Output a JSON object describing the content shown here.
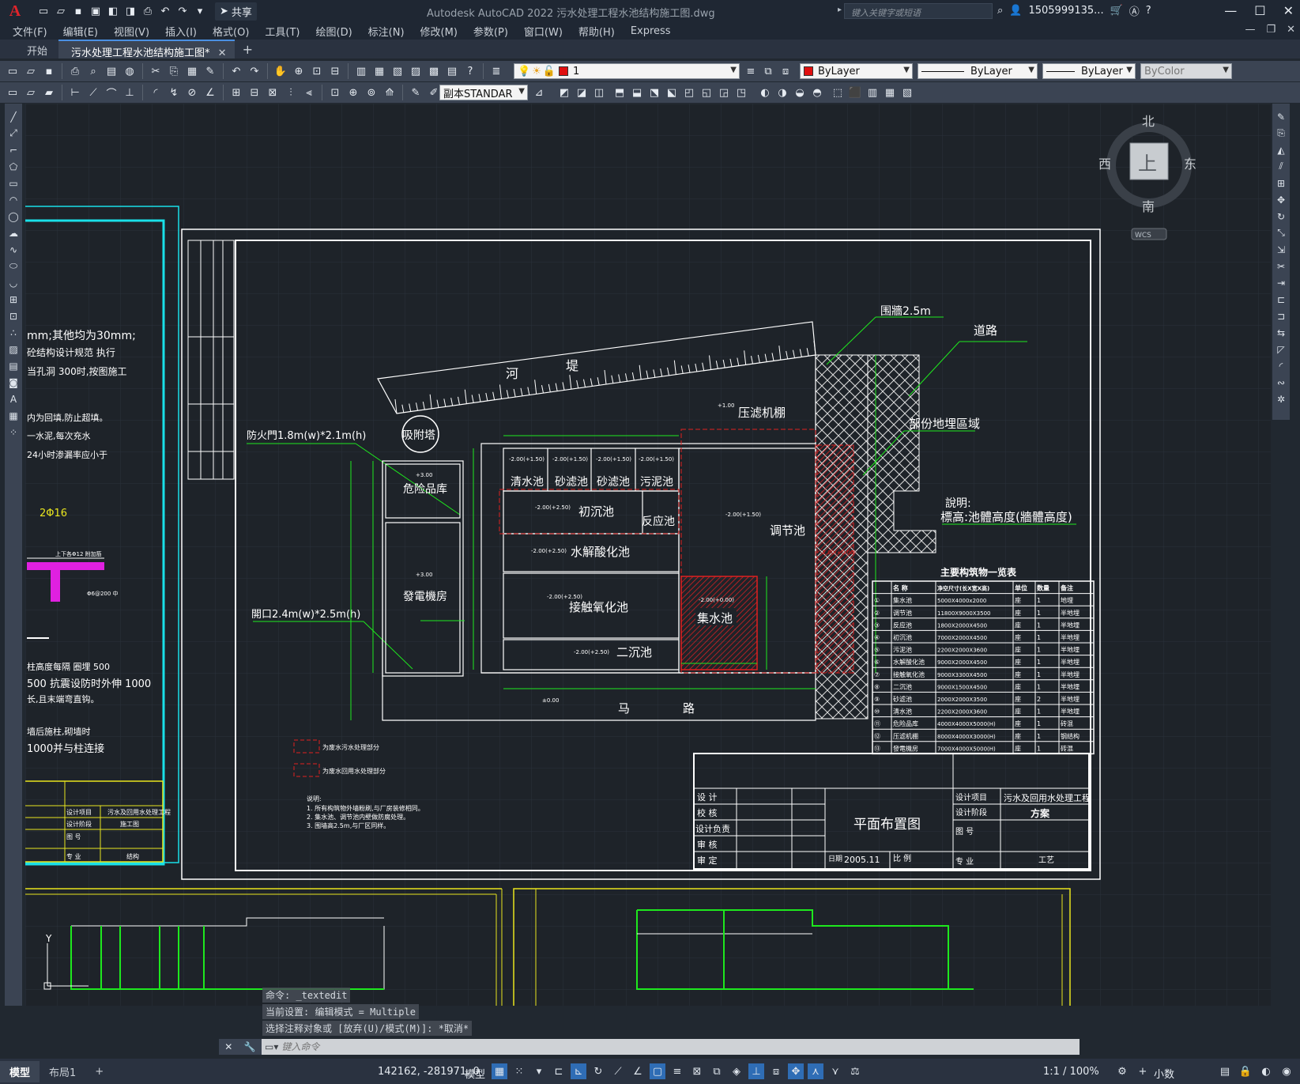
{
  "titlebar": {
    "app_logo": "A",
    "share_label": "共享",
    "window_title": "Autodesk AutoCAD 2022    污水处理工程水池结构施工图.dwg",
    "search_placeholder": "键入关键字或短语",
    "user_name": "1505999135...",
    "controls": [
      "—",
      "☐",
      "✕"
    ]
  },
  "menus": [
    "文件(F)",
    "编辑(E)",
    "视图(V)",
    "插入(I)",
    "格式(O)",
    "工具(T)",
    "绘图(D)",
    "标注(N)",
    "修改(M)",
    "参数(P)",
    "窗口(W)",
    "帮助(H)",
    "Express"
  ],
  "tabs": {
    "start": "开始",
    "active": "污水处理工程水池结构施工图*",
    "close": "✕",
    "add": "+"
  },
  "toolbar1": {
    "layer_value": "1",
    "color_value": "ByLayer",
    "linetype_value": "ByLayer",
    "lineweight_value": "ByLayer",
    "plotstyle_value": "ByColor"
  },
  "toolbar2": {
    "textstyle_value": "副本STANDAR"
  },
  "viewcube": {
    "north": "北",
    "south": "南",
    "east": "东",
    "west": "西",
    "top": "上",
    "wcs": "WCS"
  },
  "drawing": {
    "left_notes": [
      "mm;其他均为30mm;",
      "砼结构设计规范 执行",
      "当孔洞 300时,按图施工",
      "内为回填,防止超填。",
      "一水泥,每次充水",
      "24小时渗漏率应小于",
      "2Φ16",
      "上下各Φ12 附加筋",
      "Φ6@200 中",
      "柱高度每隔  圈埋   500",
      "500 抗震设防时外伸 1000",
      "长,且末端弯直钩。",
      "墙后施柱,砌墙时",
      "1000并与柱连接"
    ],
    "left_title": {
      "item": "设计项目",
      "item_value": "污水及回用水处理工程",
      "stage": "设计阶段",
      "stage_value": "施工图",
      "drawing_no": "图 号",
      "major": "专 业",
      "major_value": "结构"
    },
    "labels": {
      "river_bank_1": "河",
      "river_bank_2": "堤",
      "wall": "围牆2.5m",
      "road_label": "道路",
      "partial_buried": "部份地埋區域",
      "adsorption_tower": "吸附塔",
      "filter_press": "压滤机棚",
      "fire_door": "防火門1.8m(w)*2.1m(h)",
      "hazard_store": "危险品库",
      "generator_room": "發電機房",
      "opening": "開口2.4m(w)*2.5m(h)",
      "clear_pool": "清水池",
      "sand_filter_1": "砂滤池",
      "sand_filter_2": "砂滤池",
      "sludge_pool": "污泥池",
      "primary_settling": "初沉池",
      "reaction_pool": "反应池",
      "equalization": "调节池",
      "hydrolysis": "水解酸化池",
      "contact_oxidation": "接触氧化池",
      "collection_pool": "集水池",
      "secondary_settling": "二沉池",
      "road_1": "马",
      "road_2": "路",
      "note_title": "說明:",
      "note_body": "標高:池體高度(牆體高度)",
      "legend_1": "为废水污水处理部分",
      "legend_2": "为废水回用水处理部分",
      "small_notes": [
        "说明:",
        "1. 所有构筑物外墙粉刷,与厂房装修相同。",
        "2. 集水池、调节池内壁做防腐处理。",
        "3. 围墙高2.5m,与厂区同样。"
      ]
    },
    "table": {
      "title": "主要构筑物一览表",
      "headers": [
        "",
        "名 称",
        "净空尺寸(长X宽X高)",
        "单位",
        "数量",
        "备注"
      ],
      "rows": [
        [
          "①",
          "集水池",
          "5000X4000x2000",
          "座",
          "1",
          "地埋"
        ],
        [
          "②",
          "调节池",
          "11800X9000X3500",
          "座",
          "1",
          "半地埋"
        ],
        [
          "③",
          "反应池",
          "1800X2000X4500",
          "座",
          "1",
          "半地埋"
        ],
        [
          "④",
          "初沉池",
          "7000X2000X4500",
          "座",
          "1",
          "半地埋"
        ],
        [
          "⑤",
          "污泥池",
          "2200X2000X3600",
          "座",
          "1",
          "半地埋"
        ],
        [
          "⑥",
          "水解酸化池",
          "9000X2000X4500",
          "座",
          "1",
          "半地埋"
        ],
        [
          "⑦",
          "接触氧化池",
          "9000X3300X4500",
          "座",
          "1",
          "半地埋"
        ],
        [
          "⑧",
          "二沉池",
          "9000X1500X4500",
          "座",
          "1",
          "半地埋"
        ],
        [
          "⑨",
          "砂滤池",
          "2000X2000X3500",
          "座",
          "2",
          "半地埋"
        ],
        [
          "⑩",
          "清水池",
          "2200X2000X3600",
          "座",
          "1",
          "半地埋"
        ],
        [
          "⑪",
          "危险品库",
          "4000X4000X5000(H)",
          "座",
          "1",
          "砖混"
        ],
        [
          "⑫",
          "压滤机棚",
          "8000X4000X3000(H)",
          "座",
          "1",
          "钢结构"
        ],
        [
          "⑬",
          "發電機房",
          "7000X4000X5000(H)",
          "座",
          "1",
          "砖混"
        ]
      ]
    },
    "titleblock": {
      "design": "设 计",
      "check": "校 核",
      "chief": "设计负责",
      "review": "审 核",
      "approve": "审 定",
      "drawing_name": "平面布置图",
      "date_label": "日期",
      "date_value": "2005.11",
      "scale_label": "比 例",
      "item_label": "设计项目",
      "item_value": "污水及回用水处理工程",
      "stage_label": "设计阶段",
      "stage_value": "方案",
      "no_label": "图 号",
      "major_label": "专 业",
      "major_value": "工艺"
    },
    "elevations": [
      "-2.00(+1.50)",
      "-2.00(+2.50)",
      "+3.00",
      "+1.00",
      "±0.00",
      "-2.00(+0.00)"
    ]
  },
  "command": {
    "history": [
      "命令: _textedit",
      "当前设置: 编辑模式 = Multiple",
      "选择注释对象或 [放弃(U)/模式(M)]: *取消*"
    ],
    "placeholder": "键入命令"
  },
  "statusbar": {
    "model_tab": "模型",
    "layout_tab": "布局1",
    "add": "+",
    "coordinates": "142162, -281971, 0",
    "space": "模型",
    "scale": "1:1 / 100%",
    "units": "小数"
  },
  "colors": {
    "background": "#1e2329",
    "line_white": "#ffffff",
    "cyan": "#19e0e8",
    "green": "#1ee81e",
    "red": "#e02020",
    "yellow": "#e8e41e",
    "magenta": "#e020e0"
  }
}
